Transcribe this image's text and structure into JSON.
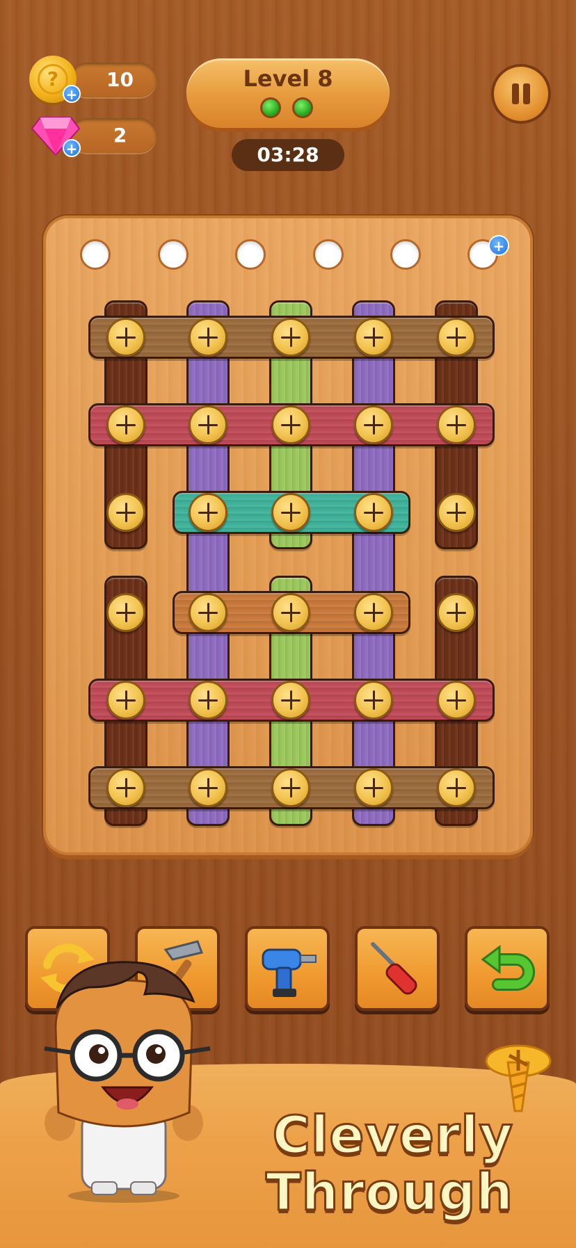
{
  "hud": {
    "coins": "10",
    "gems": "2",
    "coin_icon": "coin-icon",
    "gem_icon": "gem-icon"
  },
  "level": {
    "title": "Level 8",
    "progress_dots": 2
  },
  "timer": "03:28",
  "board": {
    "empty_holes": 6,
    "plank_colors": {
      "dark_brown": "#6b2f17",
      "purple": "#8e6bc0",
      "green": "#9bc75c",
      "light_brown": "#9a6a3c",
      "red": "#bf4a57",
      "teal": "#3fb29a",
      "orange": "#c8783a"
    }
  },
  "tools": [
    {
      "name": "shuffle-tool",
      "icon": "shuffle-icon"
    },
    {
      "name": "hammer-tool",
      "icon": "hammer-icon"
    },
    {
      "name": "drill-tool",
      "icon": "drill-icon"
    },
    {
      "name": "screwdriver-tool",
      "icon": "screwdriver-icon"
    },
    {
      "name": "undo-tool",
      "icon": "undo-icon"
    }
  ],
  "slogan": {
    "line1": "Cleverly",
    "line2": "Through"
  }
}
